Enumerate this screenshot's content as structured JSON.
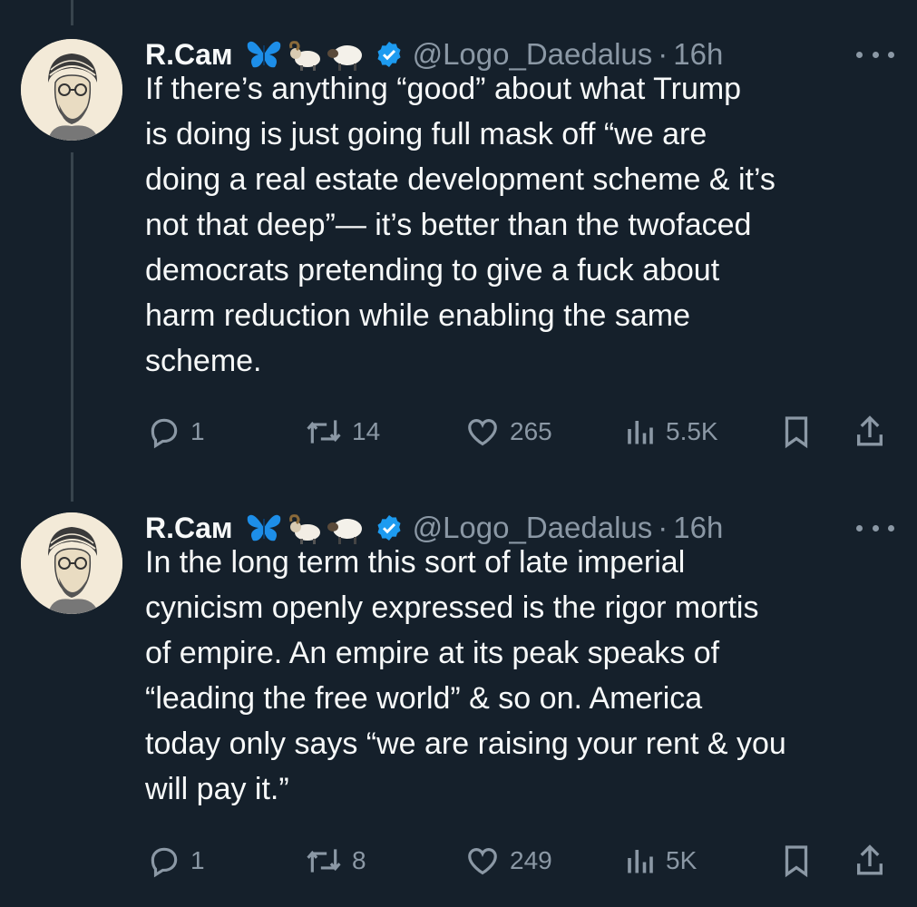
{
  "tweets": [
    {
      "display_name": "R.Cам",
      "emojis": [
        "butterfly-emoji",
        "ram-emoji",
        "sheep-emoji"
      ],
      "handle": "@Logo_Daedalus",
      "separator": "·",
      "time": "16h",
      "lines": [
        "If there’s anything “good” about what Trump",
        "is doing is just going full mask off “we are",
        "doing a real estate development scheme & it’s",
        "not that deep”— it’s better than the twofaced",
        "democrats pretending to give a fuck about",
        "harm reduction while enabling the same",
        "scheme."
      ],
      "replies": "1",
      "retweets": "14",
      "likes": "265",
      "views": "5.5K"
    },
    {
      "display_name": "R.Cам",
      "emojis": [
        "butterfly-emoji",
        "ram-emoji",
        "sheep-emoji"
      ],
      "handle": "@Logo_Daedalus",
      "separator": "·",
      "time": "16h",
      "lines": [
        "In the long term this sort of late imperial",
        "cynicism openly expressed is the rigor mortis",
        "of empire. An empire at its peak speaks of",
        "“leading the free world” & so on. America",
        "today only says “we are raising your rent & you",
        "will pay it.”"
      ],
      "replies": "1",
      "retweets": "8",
      "likes": "249",
      "views": "5K"
    }
  ],
  "colors": {
    "background": "#15202b",
    "text": "#f7f9f9",
    "muted": "#8b98a5",
    "verified": "#1d9bf0",
    "thread_line": "#38444d"
  }
}
